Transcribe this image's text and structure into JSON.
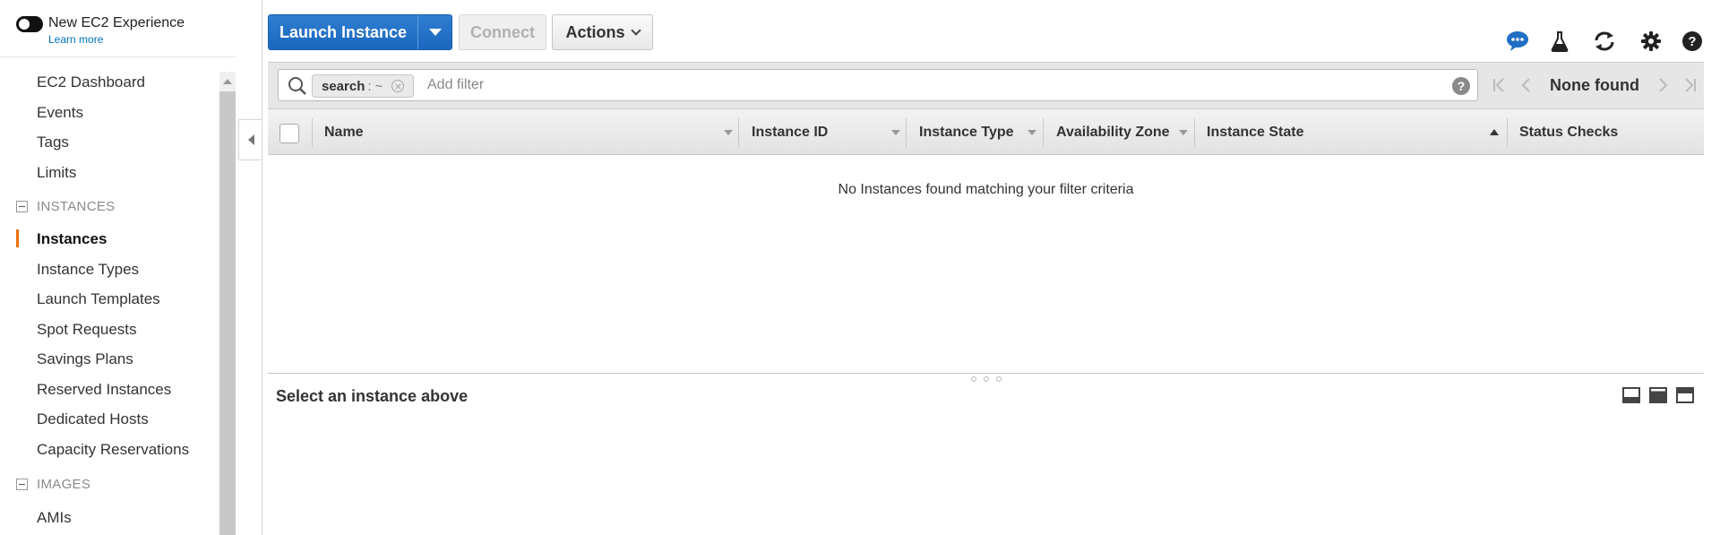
{
  "sidebar": {
    "experience_toggle_label": "New EC2 Experience",
    "learn_more": "Learn more",
    "items": {
      "ec2_dashboard": "EC2 Dashboard",
      "events": "Events",
      "tags": "Tags",
      "limits": "Limits",
      "instances": "Instances",
      "instance_types": "Instance Types",
      "launch_templates": "Launch Templates",
      "spot_requests": "Spot Requests",
      "savings_plans": "Savings Plans",
      "reserved_instances": "Reserved Instances",
      "dedicated_hosts": "Dedicated Hosts",
      "capacity_reservations": "Capacity Reservations",
      "amis": "AMIs"
    },
    "sections": {
      "instances": "INSTANCES",
      "images": "IMAGES"
    },
    "active_item": "Instances"
  },
  "toolbar": {
    "launch_label": "Launch Instance",
    "connect_label": "Connect",
    "actions_label": "Actions"
  },
  "filter": {
    "chip_key": "search",
    "chip_value": ": ~",
    "placeholder": "Add filter",
    "help": "?"
  },
  "pager": {
    "text": "None found"
  },
  "table": {
    "columns": {
      "name": "Name",
      "instance_id": "Instance ID",
      "instance_type": "Instance Type",
      "availability_zone": "Availability Zone",
      "instance_state": "Instance State",
      "status_checks": "Status Checks"
    },
    "empty_message": "No Instances found matching your filter criteria"
  },
  "detail": {
    "title": "Select an instance above"
  },
  "colors": {
    "primary_button": "#1b66bf",
    "active_accent": "#ec7211",
    "link": "#0073bb",
    "feedback_icon": "#1f6fc4"
  },
  "icons": [
    "toggle-switch",
    "chevron-down-icon",
    "chat-bubble-icon",
    "flask-icon",
    "refresh-icon",
    "gear-icon",
    "help-icon",
    "search-icon",
    "clear-icon",
    "first-page-icon",
    "prev-page-icon",
    "next-page-icon",
    "last-page-icon",
    "sort-icon",
    "collapse-icon",
    "layout-icon"
  ]
}
